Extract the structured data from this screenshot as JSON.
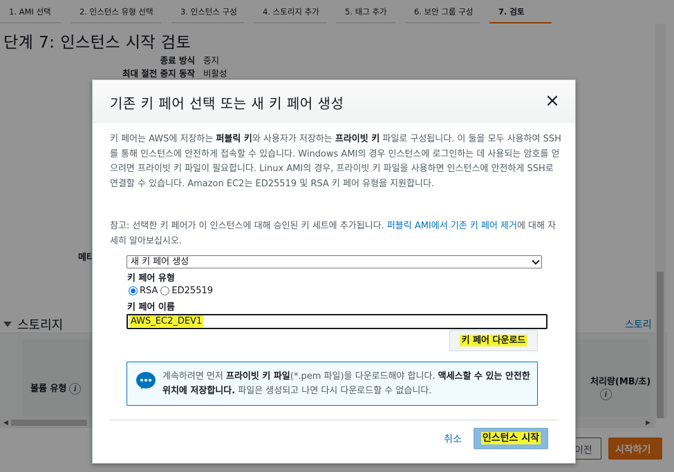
{
  "steps": [
    "1. AMI 선택",
    "2. 인스턴스 유형 선택",
    "3. 인스턴스 구성",
    "4. 스토리지 추가",
    "5. 태그 추가",
    "6. 보안 그룹 구성",
    "7. 검토"
  ],
  "page_title": "단계 7: 인스턴스 시작 검토",
  "details": [
    {
      "key": "종료 방식",
      "value": "중지"
    },
    {
      "key": "최대 절전 중지 동작",
      "value": "비활성"
    }
  ],
  "bg_fragment": "메타",
  "storage": {
    "heading": "스토리지",
    "link": "스토리",
    "col_volume_type": "볼륨 유형",
    "col_throughput": "처리량(MB/초)",
    "info": "i"
  },
  "bg_buttons": {
    "prev": "이전",
    "launch": "시작하기"
  },
  "modal": {
    "title": "기존 키 페어 선택 또는 새 키 페어 생성",
    "close": "×",
    "desc_parts": {
      "p1": "키 페어는 AWS에 저장하는 ",
      "b1": "퍼블릭 키",
      "p2": "와 사용자가 저장하는 ",
      "b2": "프라이빗 키",
      "p3": " 파일로 구성됩니다. 이 둘을 모두 사용하여 SSH를 통해 인스턴스에 안전하게 접속할 수 있습니다. Windows AMI의 경우 인스턴스에 로그인하는 데 사용되는 암호를 얻으려면 프라이빗 키 파일이 필요합니다. Linux AMI의 경우, 프라이빗 키 파일을 사용하면 인스턴스에 안전하게 SSH로 연결할 수 있습니다. Amazon EC2는 ED25519 및 RSA 키 페어 유형을 지원합니다."
    },
    "note_prefix": "참고: 선택한 키 페어가 이 인스턴스에 대해 승인된 키 세트에 추가됩니다. ",
    "note_link": "퍼블릭 AMI에서 기존 키 페어 제거",
    "note_suffix": "에 대해 자세히 알아보십시오.",
    "select_value": "새 키 페어 생성",
    "key_type_label": "키 페어 유형",
    "key_types": [
      "RSA",
      "ED25519"
    ],
    "key_type_selected": "RSA",
    "key_name_label": "키 페어 이름",
    "key_name_value": "AWS_EC2_DEV1",
    "download_label": "키 페어 다운로드",
    "info_parts": {
      "p1": "계속하려면 먼저 ",
      "b1": "프라이빗 키 파일",
      "p2": "(*.pem 파일)을 다운로드해야 합니다. ",
      "b2": "액세스할 수 있는 안전한 위치에 저장합니다.",
      "p3": " 파일은 생성되고 나면 다시 다운로드할 수 없습니다."
    },
    "cancel_label": "취소",
    "launch_label": "인스턴스 시작"
  }
}
